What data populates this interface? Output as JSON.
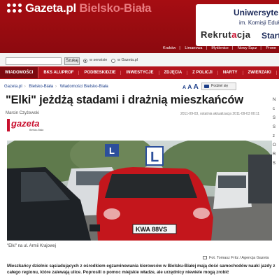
{
  "header": {
    "logo_main": "Gazeta.pl",
    "logo_city": " Bielsko-Biała",
    "ad": {
      "line1": "Uniwersyte",
      "line2": "im. Komisji Edukac",
      "line3_a": "Rekrut",
      "line3_b": "a",
      "line3_c": "cja",
      "line4": "Start"
    },
    "cities": [
      "Kraków",
      "Limanowa",
      "Myślenice",
      "Nowy Sącz",
      "Prone"
    ]
  },
  "search": {
    "placeholder": "",
    "button_label": "Szukaj",
    "option_1": "w serwisie",
    "option_2": "w Gazeta.pl"
  },
  "nav": {
    "items": [
      "WIADOMOŚCI",
      "BKS ALUPROF",
      "PODBESKIDZIE",
      "INWESTYCJE",
      "ZDJĘCIA",
      "Z POLICJI",
      "NARTY",
      "ZWIERZAKI"
    ]
  },
  "breadcrumb": [
    "Gazeta.pl",
    "Bielsko-Biała",
    "Wiadomości Bielsko-Biała"
  ],
  "font_size_label": [
    "A",
    "A",
    "A"
  ],
  "share_label": "Podziel się",
  "article": {
    "title": "\"Elki\" jeżdżą stadami i drażnią mieszkańców",
    "author": "Marcin Czyżewski",
    "dates": "2011-09-03, ostatnia aktualizacja 2011-09-03 00:11",
    "source_logo": "gazeta",
    "source_sub": "Bielsko-Biała",
    "caption": "\"Elki\" na ul. Armii Krajowej",
    "credit": "Fot. Tomasz Fritz / Agencja Gazeta",
    "lead": "Mieszkańcy dzielnic sąsiadujących z ośrodkiem egzaminowania kierowców w Bielsku-Białej mają dość samochodów nauki jazdy z całego regionu, które zalewają ulice. Poprosili o pomoc miejskie władze, ale urzędnicy niewiele mogą zrobić"
  },
  "photo": {
    "plate": "KWA 88VS",
    "sign_letter": "L"
  },
  "edge_letters": [
    "N",
    "c",
    "S",
    "S",
    "z",
    "O",
    "R",
    "S"
  ],
  "colors": {
    "brand_red": "#b3121b",
    "nav_active": "#7e0a10",
    "link_blue": "#1d3f8a",
    "car_red": "#c4161c"
  }
}
